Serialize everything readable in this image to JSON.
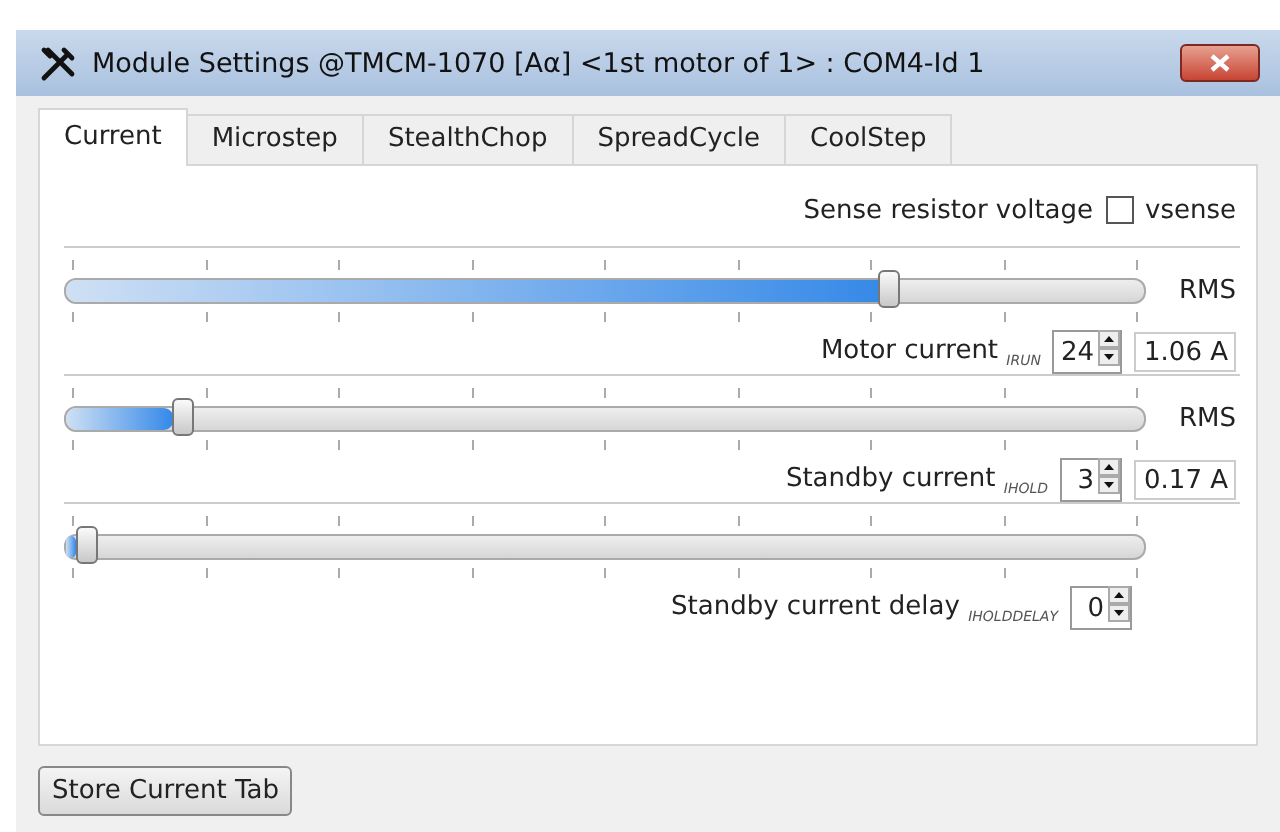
{
  "window": {
    "title": "Module Settings @TMCM-1070 [Aα] <1st motor of 1> : COM4-Id 1"
  },
  "tabs": [
    {
      "label": "Current",
      "selected": true
    },
    {
      "label": "Microstep",
      "selected": false
    },
    {
      "label": "StealthChop",
      "selected": false
    },
    {
      "label": "SpreadCycle",
      "selected": false
    },
    {
      "label": "CoolStep",
      "selected": false
    }
  ],
  "sense_resistor": {
    "label": "Sense resistor voltage",
    "checkbox_label": "vsense",
    "checked": false
  },
  "sections": [
    {
      "level": 0.77,
      "unit": "RMS",
      "label": "Motor current $_{IRUN}$",
      "value": "24",
      "reading": "1.06 A"
    },
    {
      "level": 0.1,
      "unit": "RMS",
      "label": "Standby current $_{IHOLD}$",
      "value": "3",
      "reading": "0.17 A"
    },
    {
      "level": 0.01,
      "label": "Standby current delay $_{IHOLDDELAY}$",
      "value": "0"
    }
  ],
  "buttons": [
    "Store Current Tab"
  ]
}
